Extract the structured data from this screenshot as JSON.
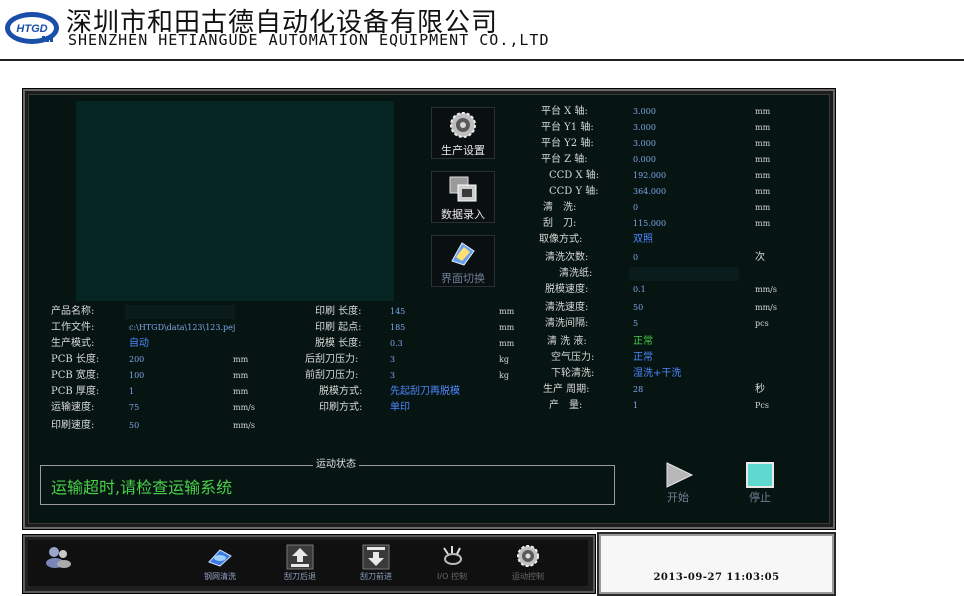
{
  "header": {
    "logo_text": "HTGD",
    "company_cn": "深圳市和田古德自动化设备有限公司",
    "company_en": "SHENZHEN HETIANGUDE AUTOMATION EQUIPMENT CO.,LTD"
  },
  "side_buttons": [
    {
      "label": "生产设置",
      "icon": "gear-icon"
    },
    {
      "label": "数据录入",
      "icon": "data-entry-icon"
    },
    {
      "label": "界面切换",
      "icon": "interface-switch-icon"
    }
  ],
  "left_params": [
    {
      "label": "产品名称:",
      "value": "",
      "unit": ""
    },
    {
      "label": "工作文件:",
      "value": "c:\\HTGD\\data\\123\\123.pej",
      "unit": ""
    },
    {
      "label": "生产模式:",
      "value": "自动",
      "unit": ""
    },
    {
      "label": "PCB 长度:",
      "value": "200",
      "unit": "mm"
    },
    {
      "label": "PCB 宽度:",
      "value": "100",
      "unit": "mm"
    },
    {
      "label": "PCB 厚度:",
      "value": "1",
      "unit": "mm"
    },
    {
      "label": "运输速度:",
      "value": "75",
      "unit": "mm/s"
    },
    {
      "label": "印刷速度:",
      "value": "50",
      "unit": "mm/s"
    }
  ],
  "mid_params": [
    {
      "label": "印刷 长度:",
      "value": "145",
      "unit": "mm"
    },
    {
      "label": "印刷 起点:",
      "value": "185",
      "unit": "mm"
    },
    {
      "label": "脱模 长度:",
      "value": "0.3",
      "unit": "mm"
    },
    {
      "label": "后刮刀压力:",
      "value": "3",
      "unit": "kg"
    },
    {
      "label": "前刮刀压力:",
      "value": "3",
      "unit": "kg"
    },
    {
      "label": "脱模方式:",
      "value": "先起刮刀再脱模",
      "unit": ""
    },
    {
      "label": "印刷方式:",
      "value": "单印",
      "unit": ""
    }
  ],
  "right_params": [
    {
      "label": "平台 X 轴:",
      "value": "3.000",
      "unit": "mm"
    },
    {
      "label": "平台 Y1 轴:",
      "value": "3.000",
      "unit": "mm"
    },
    {
      "label": "平台 Y2 轴:",
      "value": "3.000",
      "unit": "mm"
    },
    {
      "label": "平台 Z 轴:",
      "value": "0.000",
      "unit": "mm"
    },
    {
      "label": "CCD X 轴:",
      "value": "192.000",
      "unit": "mm"
    },
    {
      "label": "CCD Y 轴:",
      "value": "364.000",
      "unit": "mm"
    },
    {
      "label": "清　洗:",
      "value": "0",
      "unit": "mm"
    },
    {
      "label": "刮　刀:",
      "value": "115.000",
      "unit": "mm"
    },
    {
      "label": "取像方式:",
      "value": "双照",
      "unit": ""
    },
    {
      "label": "清洗次数:",
      "value": "0",
      "unit": "次"
    },
    {
      "label": "清洗纸:",
      "value": "",
      "unit": ""
    },
    {
      "label": "脱模速度:",
      "value": "0.1",
      "unit": "mm/s"
    },
    {
      "label": "清洗速度:",
      "value": "50",
      "unit": "mm/s"
    },
    {
      "label": "清洗间隔:",
      "value": "5",
      "unit": "pcs"
    },
    {
      "label": "清 洗 液:",
      "value": "正常",
      "unit": ""
    },
    {
      "label": "空气压力:",
      "value": "正常",
      "unit": ""
    },
    {
      "label": "下轮清洗:",
      "value": "湿洗+干洗",
      "unit": ""
    },
    {
      "label": "生产 周期:",
      "value": "28",
      "unit": "秒"
    },
    {
      "label": "产　量:",
      "value": "1",
      "unit": "Pcs"
    }
  ],
  "status": {
    "title": "运动状态",
    "message": "运输超时,请检查运输系统"
  },
  "controls": {
    "start_label": "开始",
    "stop_label": "停止"
  },
  "toolbar": [
    {
      "label": "",
      "icon": "users-icon"
    },
    {
      "label": "钢网清洗",
      "icon": "stencil-clean-icon"
    },
    {
      "label": "刮刀后退",
      "icon": "squeegee-back-icon"
    },
    {
      "label": "刮刀前进",
      "icon": "squeegee-forward-icon"
    },
    {
      "label": "I/O 控制",
      "icon": "io-control-icon"
    },
    {
      "label": "运动控制",
      "icon": "motion-control-icon"
    }
  ],
  "clock": "2013-09-27   11:03:05",
  "colors": {
    "panel_bg": "#061512",
    "value_blue": "#7fa6e8",
    "status_green": "#4ad04a",
    "stop_cyan": "#5fd8d0"
  }
}
